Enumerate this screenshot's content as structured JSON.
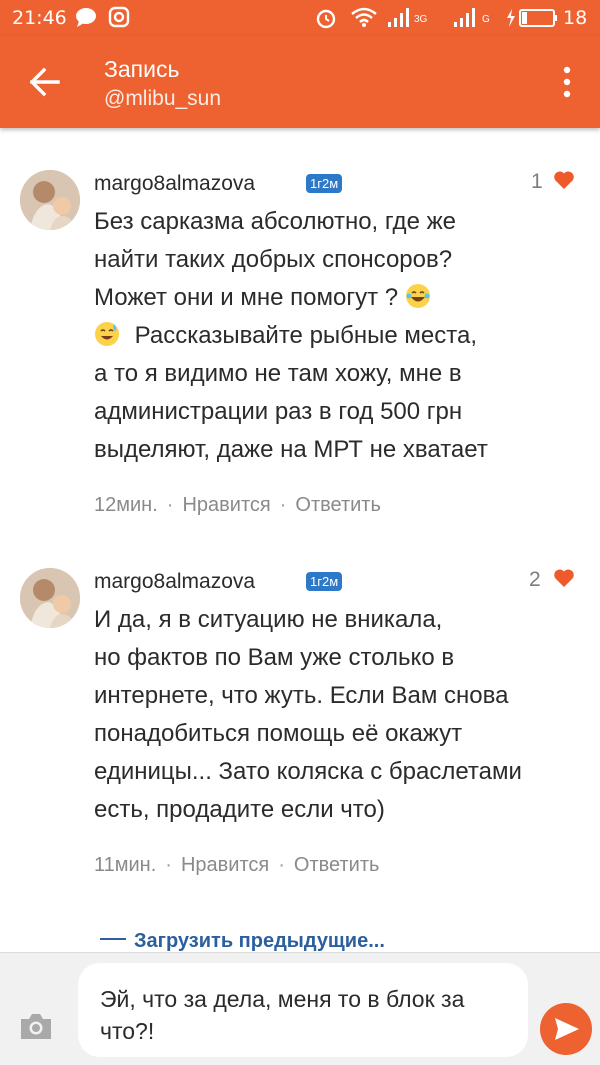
{
  "status_bar": {
    "time": "21:46",
    "battery": "18",
    "net_3g": "3G",
    "net_g": "G"
  },
  "app_bar": {
    "title": "Запись",
    "subtitle": "@mlibu_sun"
  },
  "comments": [
    {
      "author": "margo8almazova",
      "badge": "1г2м",
      "likes": "1",
      "lines": [
        "Без сарказма абсолютно, где же",
        "найти таких добрых спонсоров?",
        "Может они и мне помогут ?",
        "Рассказывайте рыбные места,",
        "а то я видимо не там хожу, мне в",
        "администрации раз в год 500 грн",
        "выделяют, даже на МРТ не хватает"
      ],
      "time": "12мин.",
      "like_action": "Нравится",
      "reply_action": "Ответить"
    },
    {
      "author": "margo8almazova",
      "badge": "1г2м",
      "likes": "2",
      "lines": [
        "И да, я в ситуацию не вникала,",
        "но фактов по Вам уже столько в",
        "интернете, что жуть. Если Вам снова",
        "понадобиться помощь её окажут",
        "единицы... Зато коляска с браслетами",
        "есть, продадите если что)"
      ],
      "time": "11мин.",
      "like_action": "Нравится",
      "reply_action": "Ответить"
    }
  ],
  "load_more": "Загрузить предыдущие...",
  "composer": {
    "message": "Эй, что за дела, меня то в блок за что?!"
  },
  "colors": {
    "accent": "#ee6130",
    "badge": "#2e79c7",
    "link": "#2c5f9e"
  },
  "icons": [
    "back-arrow-icon",
    "overflow-menu-icon",
    "heart-icon",
    "camera-icon",
    "send-icon",
    "laughing-emoji-icon",
    "sweat-smile-emoji-icon"
  ]
}
